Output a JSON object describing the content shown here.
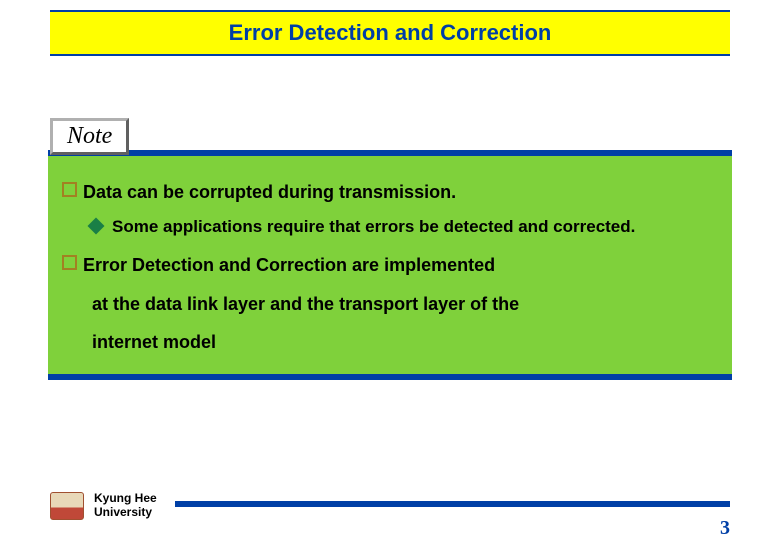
{
  "title": "Error Detection and Correction",
  "note_label": "Note",
  "bullets": {
    "b1": "Data can be corrupted during transmission.",
    "b1_sub": "Some applications require that errors be detected and corrected.",
    "b2_line1": "Error Detection and Correction are implemented",
    "b2_line2": "at the data link layer and the transport layer of the",
    "b2_line3": "internet model"
  },
  "footer": {
    "university_line1": "Kyung Hee",
    "university_line2": "University",
    "page_number": "3"
  }
}
